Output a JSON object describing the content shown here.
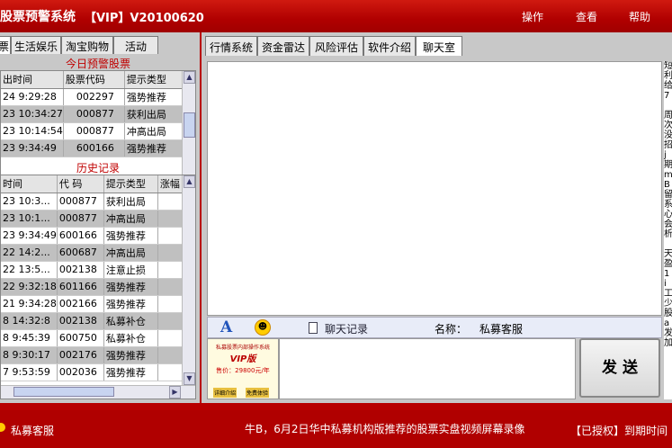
{
  "app": {
    "title": "股票预警系统",
    "version": "【VIP】V20100620"
  },
  "menu": {
    "items": [
      "操作",
      "查看",
      "帮助"
    ]
  },
  "left_tabs": [
    "票",
    "生活娱乐",
    "淘宝购物",
    "活动"
  ],
  "alerts": {
    "title": "今日预警股票",
    "columns": [
      "出时间",
      "股票代码",
      "提示类型"
    ],
    "rows": [
      [
        "24 9:29:28",
        "002297",
        "强势推荐"
      ],
      [
        "23 10:34:27",
        "000877",
        "获利出局"
      ],
      [
        "23 10:14:54",
        "000877",
        "冲高出局"
      ],
      [
        "23 9:34:49",
        "600166",
        "强势推荐"
      ]
    ]
  },
  "history": {
    "title": "历史记录",
    "columns": [
      "时间",
      "代 码",
      "提示类型",
      "涨幅"
    ],
    "rows": [
      [
        "23 10:3...",
        "000877",
        "获利出局",
        ""
      ],
      [
        "23 10:1...",
        "000877",
        "冲高出局",
        ""
      ],
      [
        "23 9:34:49",
        "600166",
        "强势推荐",
        ""
      ],
      [
        "22 14:2...",
        "600687",
        "冲高出局",
        ""
      ],
      [
        "22 13:5...",
        "002138",
        "注意止损",
        ""
      ],
      [
        "22 9:32:18",
        "601166",
        "强势推荐",
        ""
      ],
      [
        "21 9:34:28",
        "002166",
        "强势推荐",
        ""
      ],
      [
        "8 14:32:8",
        "002138",
        "私募补仓",
        ""
      ],
      [
        "8 9:45:39",
        "600750",
        "私募补仓",
        ""
      ],
      [
        "8 9:30:17",
        "002176",
        "强势推荐",
        ""
      ],
      [
        "7 9:53:59",
        "002036",
        "强势推荐",
        ""
      ]
    ]
  },
  "right_tabs": [
    "行情系统",
    "资金雷达",
    "风险评估",
    "软件介绍",
    "聊天室"
  ],
  "chat": {
    "font_icon": "A",
    "history_label": "聊天记录",
    "name_label": "名称：",
    "name_value": "私募客服",
    "send_label": "发 送",
    "ad_title": "私募股票内部操作系统",
    "ad_vip": "VIP版",
    "ad_price": "售价：29800元/年",
    "ad_btn1": "详细介绍",
    "ad_btn2": "免费体验",
    "side_text": [
      "短",
      "利",
      "给",
      "7",
      "",
      "周",
      "次",
      "没",
      "招",
      "j",
      "期",
      "m",
      "B",
      "留",
      "系",
      "心",
      "会",
      "析",
      "",
      "天",
      "盈",
      "1",
      "i",
      "工",
      "少",
      "股",
      "a",
      "发",
      "加"
    ]
  },
  "status": {
    "left_label": "私募客服",
    "marquee": "牛B，6月2日华中私募机构版推荐的股票实盘视频屏幕录像",
    "right_label": "【已授权】到期时间"
  },
  "colors": {
    "brand_red": "#b00000",
    "alert_red": "#c00000"
  }
}
